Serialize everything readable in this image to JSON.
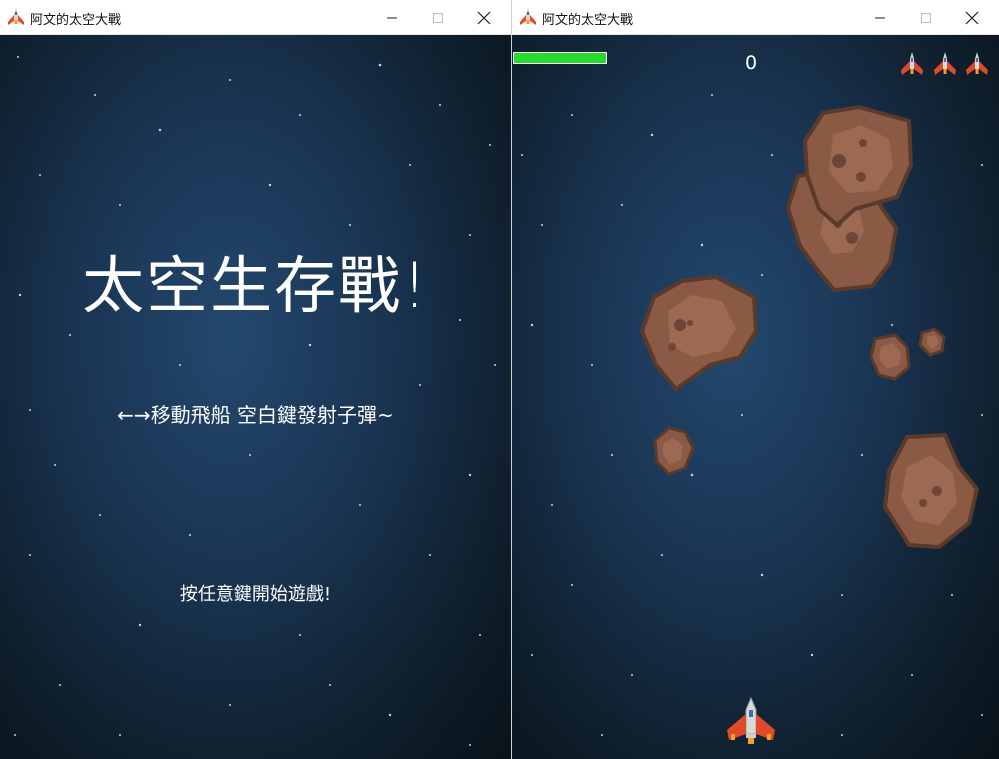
{
  "left_window": {
    "title": "阿文的太空大戰",
    "icon": "spaceship-icon",
    "title_screen": {
      "heading": "太空生存戰!",
      "instructions": "←→移動飛船 空白鍵發射子彈~",
      "start_prompt": "按任意鍵開始遊戲!"
    }
  },
  "right_window": {
    "title": "阿文的太空大戰",
    "icon": "spaceship-icon",
    "hud": {
      "score": "0",
      "health_fraction": 1.0,
      "lives": 3
    },
    "meteors": 7
  },
  "colors": {
    "health": "#26d92a",
    "meteor": "#8a5a44",
    "meteor_outline": "#5a3a2a",
    "ship_body": "#d8d8d8",
    "ship_wings": "#e04a2a"
  }
}
